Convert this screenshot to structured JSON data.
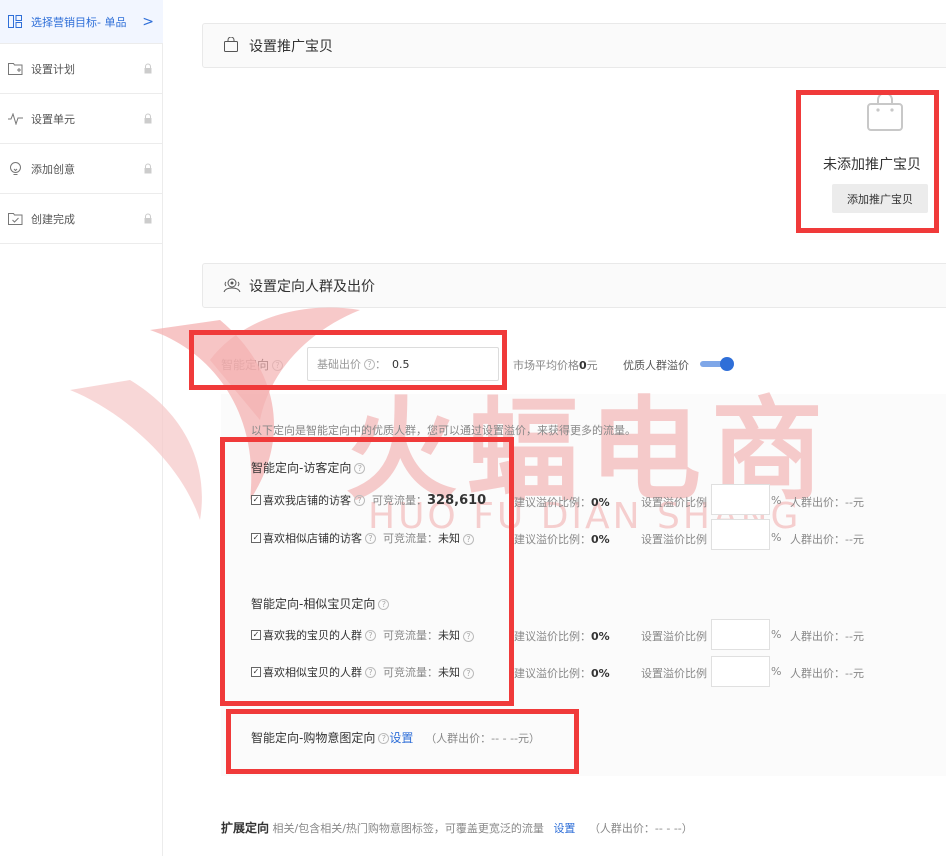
{
  "sidebar": {
    "steps": [
      {
        "label": "选择营销目标- 单品",
        "icon": "grid-icon",
        "active": true
      },
      {
        "label": "设置计划",
        "icon": "plan-icon"
      },
      {
        "label": "设置单元",
        "icon": "pulse-icon"
      },
      {
        "label": "添加创意",
        "icon": "bulb-icon"
      },
      {
        "label": "创建完成",
        "icon": "done-icon"
      }
    ],
    "arrow": ">"
  },
  "promo_section": {
    "title": "设置推广宝贝",
    "empty_text": "未添加推广宝贝",
    "add_button": "添加推广宝贝"
  },
  "crowd_section": {
    "title": "设置定向人群及出价",
    "smart_label": "智能定向",
    "bid_label": "基础出价",
    "bid_colon": "：",
    "bid_value": "0.5",
    "avg_prefix": "市场平均价格",
    "avg_value": "0",
    "avg_unit": "元",
    "premium_label": "优质人群溢价",
    "premium_on": true,
    "hint": "以下定向是智能定向中的优质人群，您可以通过设置溢价，来获得更多的流量。",
    "group1_title": "智能定向-访客定向",
    "group2_title": "智能定向-相似宝贝定向",
    "group3_title": "智能定向-购物意图定向",
    "group3_link": "设置",
    "group3_suffix": "（人群出价：-- - --元）",
    "rows": [
      {
        "name": "喜欢我店铺的访客",
        "flow_label": "可竞流量：",
        "flow_value": "328,610",
        "suggest_label": "建议溢价比例：",
        "suggest_value": "0%",
        "set_label": "设置溢价比例",
        "pct": "%",
        "crowd_bid": "人群出价：--元"
      },
      {
        "name": "喜欢相似店铺的访客",
        "flow_label": "可竞流量：",
        "flow_value": "未知",
        "suggest_label": "建议溢价比例：",
        "suggest_value": "0%",
        "set_label": "设置溢价比例",
        "pct": "%",
        "crowd_bid": "人群出价：--元"
      },
      {
        "name": "喜欢我的宝贝的人群",
        "flow_label": "可竞流量：",
        "flow_value": "未知",
        "suggest_label": "建议溢价比例：",
        "suggest_value": "0%",
        "set_label": "设置溢价比例",
        "pct": "%",
        "crowd_bid": "人群出价：--元"
      },
      {
        "name": "喜欢相似宝贝的人群",
        "flow_label": "可竞流量：",
        "flow_value": "未知",
        "suggest_label": "建议溢价比例：",
        "suggest_value": "0%",
        "set_label": "设置溢价比例",
        "pct": "%",
        "crowd_bid": "人群出价：--元"
      }
    ],
    "expand_label": "扩展定向",
    "expand_desc": "相关/包含相关/热门购物意图标签，可覆盖更宽泛的流量",
    "expand_link": "设置",
    "expand_suffix": "（人群出价：-- - --）"
  },
  "watermark": {
    "text_cn": "火蝠电商",
    "text_en": "HUO FU DIAN SHANG"
  },
  "colors": {
    "accent": "#2f6fd8",
    "highlight_box": "#f03a3a",
    "watermark": "#f4a6a6"
  }
}
